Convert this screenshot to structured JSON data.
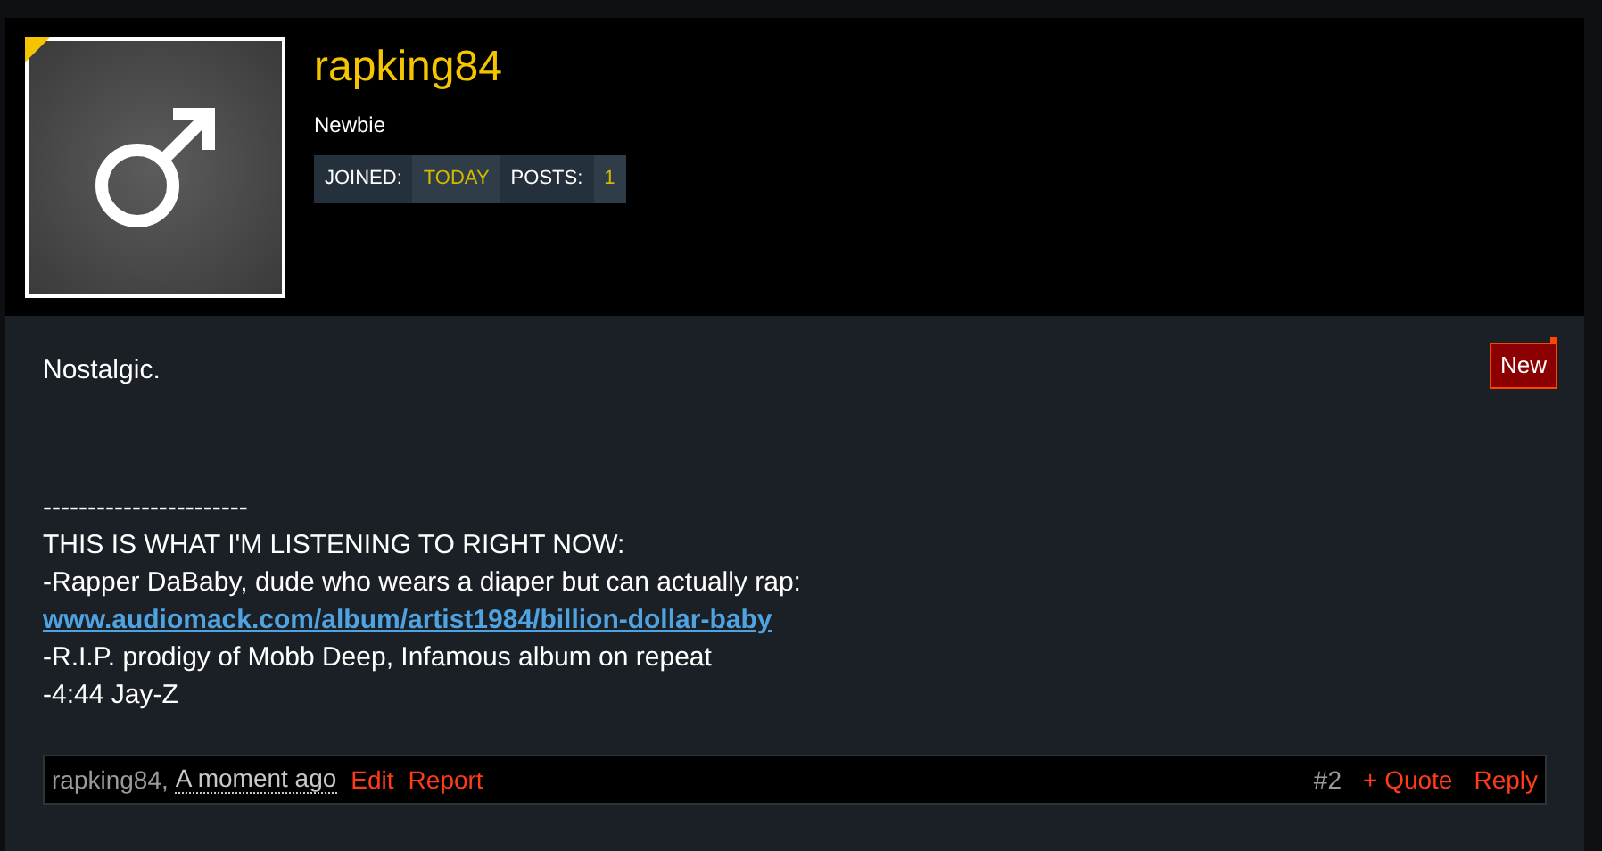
{
  "user": {
    "name": "rapking84",
    "rank": "Newbie",
    "stats": [
      {
        "label": "JOINED:",
        "value": "TODAY"
      },
      {
        "label": "POSTS:",
        "value": "1"
      }
    ]
  },
  "post": {
    "badge": "New",
    "lines": [
      {
        "kind": "text",
        "text": "Nostalgic."
      },
      {
        "kind": "gap"
      },
      {
        "kind": "text",
        "text": "-----------------------"
      },
      {
        "kind": "text",
        "text": "THIS IS WHAT I'M LISTENING TO RIGHT NOW:"
      },
      {
        "kind": "text",
        "text": "-Rapper DaBaby, dude who wears a diaper but can actually rap:"
      },
      {
        "kind": "link",
        "text": "www.audiomack.com/album/artist1984/billion-dollar-baby"
      },
      {
        "kind": "text",
        "text": "-R.I.P. prodigy of Mobb Deep, Infamous album on repeat"
      },
      {
        "kind": "text",
        "text": "-4:44 Jay-Z"
      }
    ]
  },
  "footer": {
    "author": "rapking84,",
    "time": "A moment ago",
    "left_actions": [
      "Edit",
      "Report"
    ],
    "number": "#2",
    "right_actions": [
      "+ Quote",
      "Reply"
    ]
  }
}
